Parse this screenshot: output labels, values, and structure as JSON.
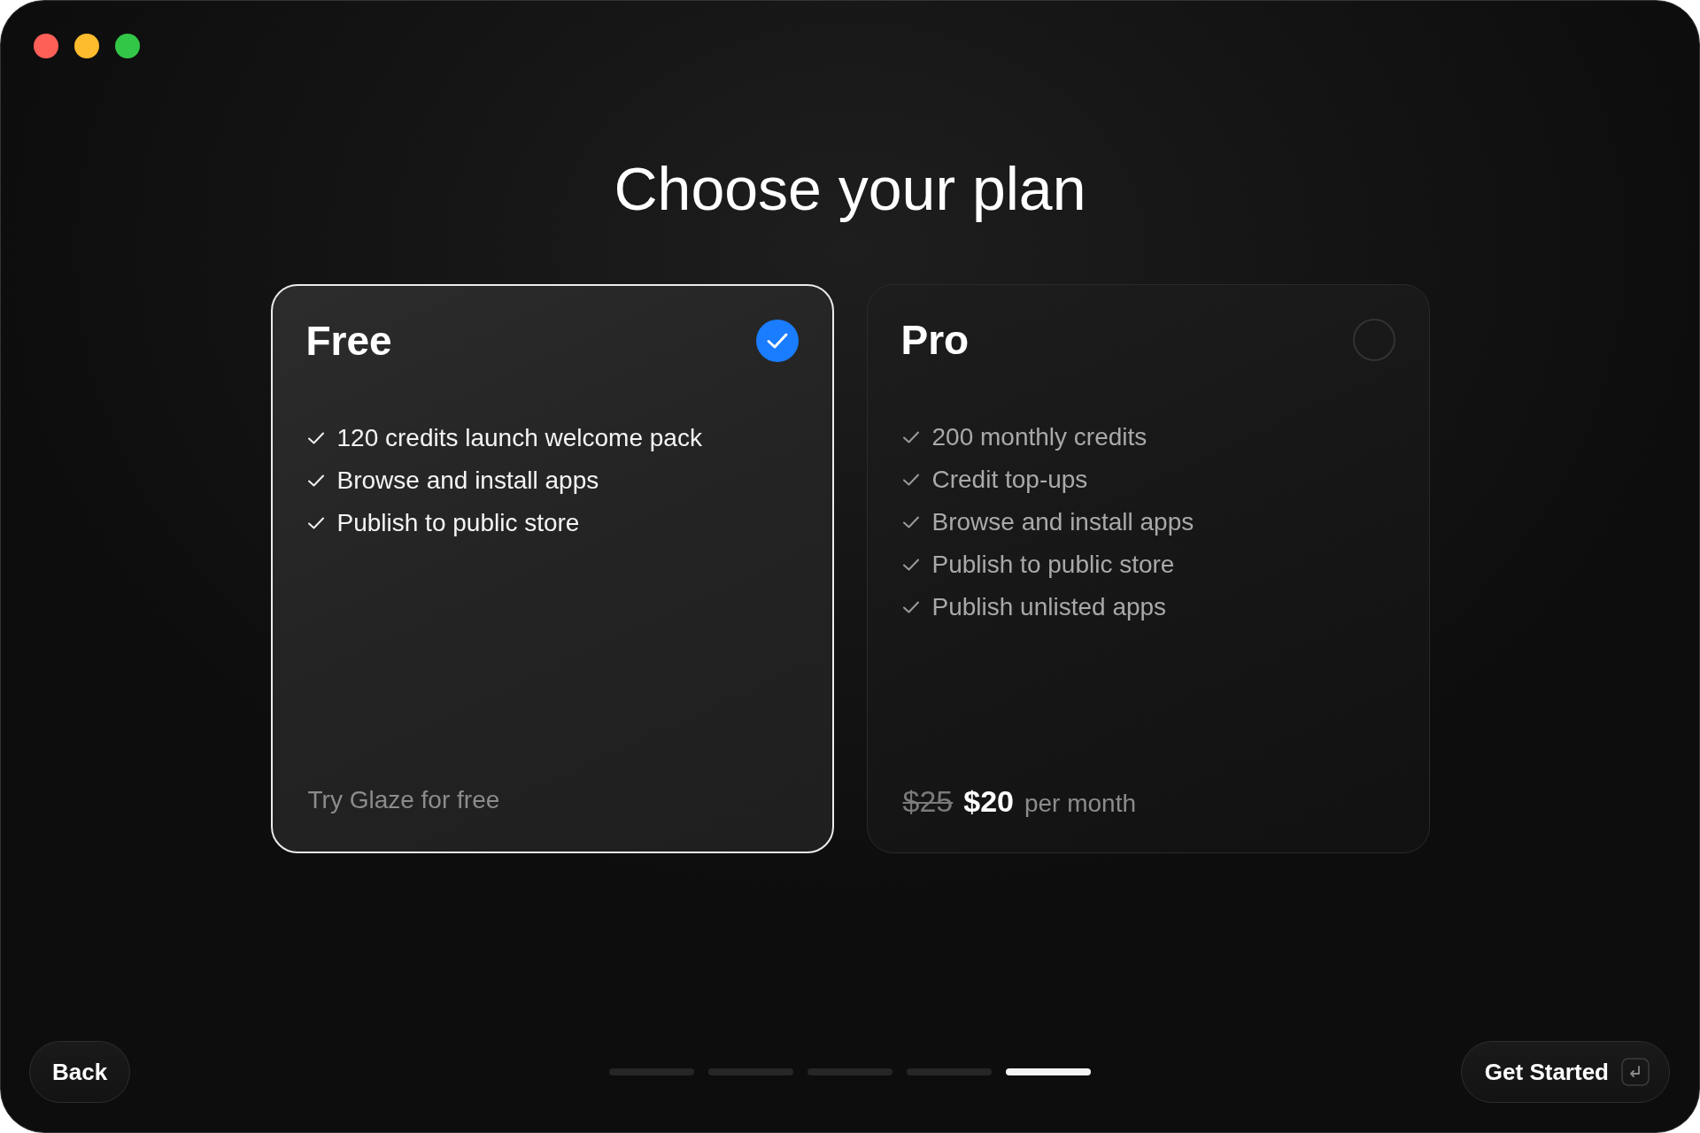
{
  "window": {
    "controls": [
      {
        "color": "#fe5f57"
      },
      {
        "color": "#fdbc2e"
      },
      {
        "color": "#33c748"
      }
    ]
  },
  "title": "Choose your plan",
  "plans": [
    {
      "name": "Free",
      "selected": true,
      "features": [
        "120 credits launch welcome pack",
        "Browse and install apps",
        "Publish to public store"
      ],
      "footer": {
        "kind": "note",
        "text": "Try Glaze for free"
      }
    },
    {
      "name": "Pro",
      "selected": false,
      "features": [
        "200 monthly credits",
        "Credit top-ups",
        "Browse and install apps",
        "Publish to public store",
        "Publish unlisted apps"
      ],
      "footer": {
        "kind": "price",
        "old_price": "$25",
        "price": "$20",
        "period": "per month"
      }
    }
  ],
  "steps": [
    {
      "selected": false
    },
    {
      "selected": false
    },
    {
      "selected": false
    },
    {
      "selected": false
    },
    {
      "selected": true
    }
  ],
  "back_button": "Back",
  "next_button": "Get Started"
}
